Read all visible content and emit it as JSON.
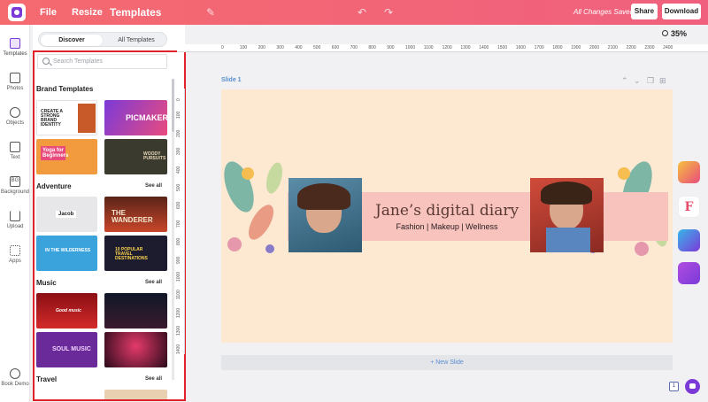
{
  "topbar": {
    "menu": [
      "File",
      "Resize",
      "Templates"
    ],
    "saved_status": "All Changes Saved",
    "share_label": "Share",
    "download_label": "Download"
  },
  "leftnav": {
    "items": [
      {
        "label": "Templates",
        "icon": "templates-icon"
      },
      {
        "label": "Photos",
        "icon": "photos-icon"
      },
      {
        "label": "Objects",
        "icon": "objects-icon"
      },
      {
        "label": "Text",
        "icon": "text-icon"
      },
      {
        "label": "Background",
        "icon": "background-icon",
        "glyph": "BG"
      },
      {
        "label": "Upload",
        "icon": "upload-icon"
      },
      {
        "label": "Apps",
        "icon": "apps-icon"
      },
      {
        "label": "Book Demo",
        "icon": "book-demo-icon"
      }
    ]
  },
  "panel": {
    "tabs": [
      "Discover",
      "All Templates"
    ],
    "search_placeholder": "Search Templates",
    "sections": [
      {
        "title": "Brand Templates",
        "see_all": ""
      },
      {
        "title": "Adventure",
        "see_all": "See all"
      },
      {
        "title": "Music",
        "see_all": "See all"
      },
      {
        "title": "Travel",
        "see_all": "See all"
      }
    ],
    "thumbs": {
      "t1": "CREATE A STRONG BRAND IDENTITY",
      "t2": "PICMAKER",
      "t3": "Yoga for Beginners",
      "t4": "WOODY PURSUITS",
      "t5": "Jacob",
      "t6": "THE WANDERER",
      "t7": "IN THE WILDERNESS",
      "t8": "10 POPULAR TRAVEL DESTINATIONS",
      "t9": "Good music",
      "t10": "",
      "t11": "SOUL MUSIC",
      "t12": ""
    }
  },
  "canvas": {
    "zoom": "35%",
    "slide_label": "Slide 1",
    "headline": "Jane’s digital diary",
    "subline": "Fashion | Makeup | Wellness",
    "new_slide": "+ New Slide",
    "page_number": "1",
    "ruler_top": [
      "0",
      "100",
      "200",
      "300",
      "400",
      "500",
      "600",
      "700",
      "800",
      "900",
      "1000",
      "1100",
      "1200",
      "1300",
      "1400",
      "1500",
      "1600",
      "1700",
      "1800",
      "1900",
      "2000",
      "2100",
      "2200",
      "2300",
      "2400"
    ],
    "ruler_left": [
      "0",
      "100",
      "200",
      "300",
      "400",
      "500",
      "600",
      "700",
      "800",
      "900",
      "1000",
      "1100",
      "1200",
      "1300",
      "1400"
    ]
  },
  "colors": {
    "brand_gradient_start": "#f46a6f",
    "brand_gradient_end": "#f0607e",
    "accent_purple": "#7b3ad8",
    "highlight_border": "#e0232b",
    "slide_bg": "#fde9d2",
    "band": "#f8c2bd"
  }
}
